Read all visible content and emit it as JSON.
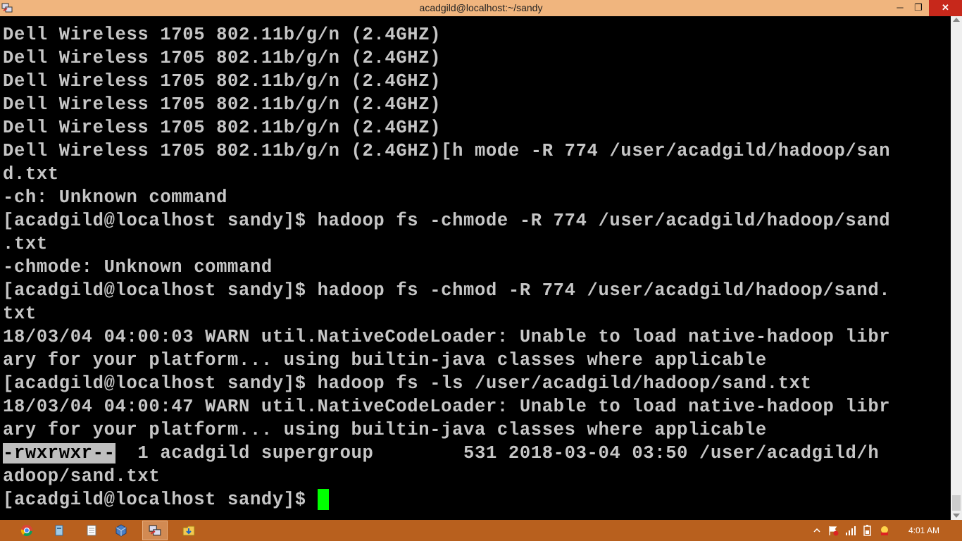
{
  "window": {
    "title": "acadgild@localhost:~/sandy",
    "minimize_label": "─",
    "restore_label": "❐",
    "close_label": "✕"
  },
  "terminal": {
    "lines": [
      "Dell Wireless 1705 802.11b/g/n (2.4GHZ)",
      "Dell Wireless 1705 802.11b/g/n (2.4GHZ)",
      "Dell Wireless 1705 802.11b/g/n (2.4GHZ)",
      "Dell Wireless 1705 802.11b/g/n (2.4GHZ)",
      "Dell Wireless 1705 802.11b/g/n (2.4GHZ)",
      "Dell Wireless 1705 802.11b/g/n (2.4GHZ)[h mode -R 774 /user/acadgild/hadoop/san",
      "d.txt",
      "-ch: Unknown command",
      "[acadgild@localhost sandy]$ hadoop fs -chmode -R 774 /user/acadgild/hadoop/sand",
      ".txt",
      "-chmode: Unknown command",
      "[acadgild@localhost sandy]$ hadoop fs -chmod -R 774 /user/acadgild/hadoop/sand.",
      "txt",
      "18/03/04 04:00:03 WARN util.NativeCodeLoader: Unable to load native-hadoop libr",
      "ary for your platform... using builtin-java classes where applicable",
      "[acadgild@localhost sandy]$ hadoop fs -ls /user/acadgild/hadoop/sand.txt",
      "18/03/04 04:00:47 WARN util.NativeCodeLoader: Unable to load native-hadoop libr",
      "ary for your platform... using builtin-java classes where applicable"
    ],
    "ls_selected": "-rwxrwxr--",
    "ls_rest": "  1 acadgild supergroup        531 2018-03-04 03:50 /user/acadgild/h",
    "ls_wrap": "adoop/sand.txt",
    "prompt": "[acadgild@localhost sandy]$ ",
    "cursor_color": "#00ff00",
    "text_color": "#c6c6c6"
  },
  "taskbar": {
    "clock": "4:01 AM",
    "apps": [
      "chrome-icon",
      "explorer-icon",
      "notepad-icon",
      "virtualbox-icon",
      "putty-icon",
      "downloads-folder-icon"
    ],
    "active_app": "putty-icon",
    "accent": "#b8601e"
  }
}
